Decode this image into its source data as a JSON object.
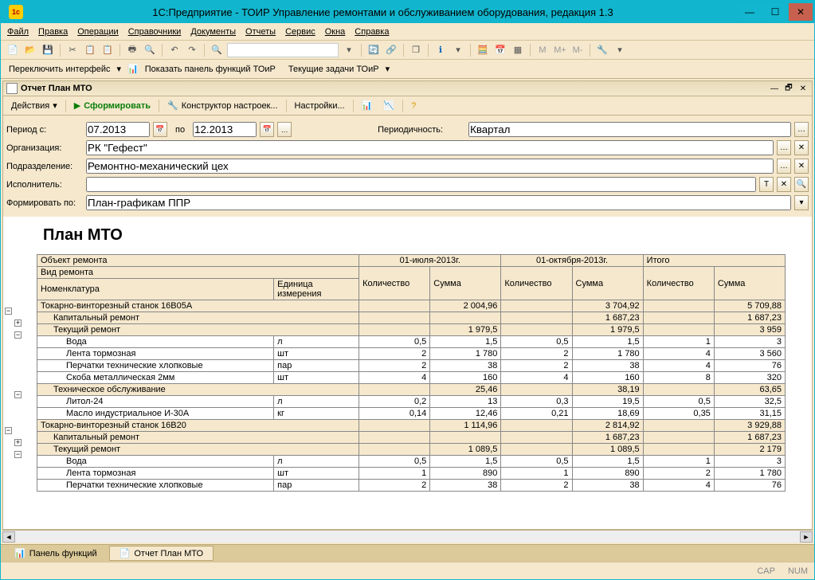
{
  "titlebar": {
    "title": "1С:Предприятие - ТОИР Управление ремонтами и обслуживанием оборудования, редакция 1.3"
  },
  "menu": {
    "file": "Файл",
    "edit": "Правка",
    "ops": "Операции",
    "refs": "Справочники",
    "docs": "Документы",
    "reports": "Отчеты",
    "service": "Сервис",
    "windows": "Окна",
    "help": "Справка"
  },
  "toolbar2": {
    "switch": "Переключить интерфейс",
    "showpanel": "Показать панель функций ТОиР",
    "tasks": "Текущие задачи ТОиР"
  },
  "doc": {
    "title": "Отчет  План МТО"
  },
  "actions": {
    "actions": "Действия",
    "form": "Сформировать",
    "constructor": "Конструктор настроек...",
    "settings": "Настройки..."
  },
  "filters": {
    "period_label": "Период с:",
    "date_from": "07.2013",
    "to": "по",
    "date_to": "12.2013",
    "periodicity_label": "Периодичность:",
    "periodicity": "Квартал",
    "org_label": "Организация:",
    "org": "РК \"Гефест\"",
    "unit_label": "Подразделение:",
    "unit": "Ремонтно-механический цех",
    "exec_label": "Исполнитель:",
    "exec": "",
    "formby_label": "Формировать по:",
    "formby": "План-графикам ППР"
  },
  "report": {
    "title": "План МТО",
    "headers": {
      "object": "Объект ремонта",
      "kind": "Вид ремонта",
      "nomen": "Номенклатура",
      "unit": "Единица измерения",
      "p1": "01-июля-2013г.",
      "p2": "01-октября-2013г.",
      "total": "Итого",
      "qty": "Количество",
      "sum": "Сумма"
    },
    "rows": [
      {
        "t": "s",
        "l": 0,
        "n": "Токарно-винторезный станок 16В05А",
        "q1": "",
        "s1": "2 004,96",
        "q2": "",
        "s2": "3 704,92",
        "qt": "",
        "st": "5 709,88"
      },
      {
        "t": "s",
        "l": 1,
        "n": "Капитальный ремонт",
        "q1": "",
        "s1": "",
        "q2": "",
        "s2": "1 687,23",
        "qt": "",
        "st": "1 687,23"
      },
      {
        "t": "s",
        "l": 1,
        "n": "Текущий ремонт",
        "q1": "",
        "s1": "1 979,5",
        "q2": "",
        "s2": "1 979,5",
        "qt": "",
        "st": "3 959"
      },
      {
        "t": "d",
        "l": 2,
        "n": "Вода",
        "u": "л",
        "q1": "0,5",
        "s1": "1,5",
        "q2": "0,5",
        "s2": "1,5",
        "qt": "1",
        "st": "3"
      },
      {
        "t": "d",
        "l": 2,
        "n": "Лента тормозная",
        "u": "шт",
        "q1": "2",
        "s1": "1 780",
        "q2": "2",
        "s2": "1 780",
        "qt": "4",
        "st": "3 560"
      },
      {
        "t": "d",
        "l": 2,
        "n": "Перчатки технические хлопковые",
        "u": "пар",
        "q1": "2",
        "s1": "38",
        "q2": "2",
        "s2": "38",
        "qt": "4",
        "st": "76"
      },
      {
        "t": "d",
        "l": 2,
        "n": "Скоба металлическая 2мм",
        "u": "шт",
        "q1": "4",
        "s1": "160",
        "q2": "4",
        "s2": "160",
        "qt": "8",
        "st": "320"
      },
      {
        "t": "s",
        "l": 1,
        "n": "Техническое обслуживание",
        "q1": "",
        "s1": "25,46",
        "q2": "",
        "s2": "38,19",
        "qt": "",
        "st": "63,65"
      },
      {
        "t": "d",
        "l": 2,
        "n": "Литол-24",
        "u": "л",
        "q1": "0,2",
        "s1": "13",
        "q2": "0,3",
        "s2": "19,5",
        "qt": "0,5",
        "st": "32,5"
      },
      {
        "t": "d",
        "l": 2,
        "n": "Масло индустриальное И-30А",
        "u": "кг",
        "q1": "0,14",
        "s1": "12,46",
        "q2": "0,21",
        "s2": "18,69",
        "qt": "0,35",
        "st": "31,15"
      },
      {
        "t": "s",
        "l": 0,
        "n": "Токарно-винторезный станок 16В20",
        "q1": "",
        "s1": "1 114,96",
        "q2": "",
        "s2": "2 814,92",
        "qt": "",
        "st": "3 929,88"
      },
      {
        "t": "s",
        "l": 1,
        "n": "Капитальный ремонт",
        "q1": "",
        "s1": "",
        "q2": "",
        "s2": "1 687,23",
        "qt": "",
        "st": "1 687,23"
      },
      {
        "t": "s",
        "l": 1,
        "n": "Текущий ремонт",
        "q1": "",
        "s1": "1 089,5",
        "q2": "",
        "s2": "1 089,5",
        "qt": "",
        "st": "2 179"
      },
      {
        "t": "d",
        "l": 2,
        "n": "Вода",
        "u": "л",
        "q1": "0,5",
        "s1": "1,5",
        "q2": "0,5",
        "s2": "1,5",
        "qt": "1",
        "st": "3"
      },
      {
        "t": "d",
        "l": 2,
        "n": "Лента тормозная",
        "u": "шт",
        "q1": "1",
        "s1": "890",
        "q2": "1",
        "s2": "890",
        "qt": "2",
        "st": "1 780"
      },
      {
        "t": "d",
        "l": 2,
        "n": "Перчатки технические хлопковые",
        "u": "пар",
        "q1": "2",
        "s1": "38",
        "q2": "2",
        "s2": "38",
        "qt": "4",
        "st": "76"
      }
    ]
  },
  "tabs": {
    "panel": "Панель функций",
    "report": "Отчет  План МТО"
  },
  "status": {
    "cap": "CAP",
    "num": "NUM"
  }
}
